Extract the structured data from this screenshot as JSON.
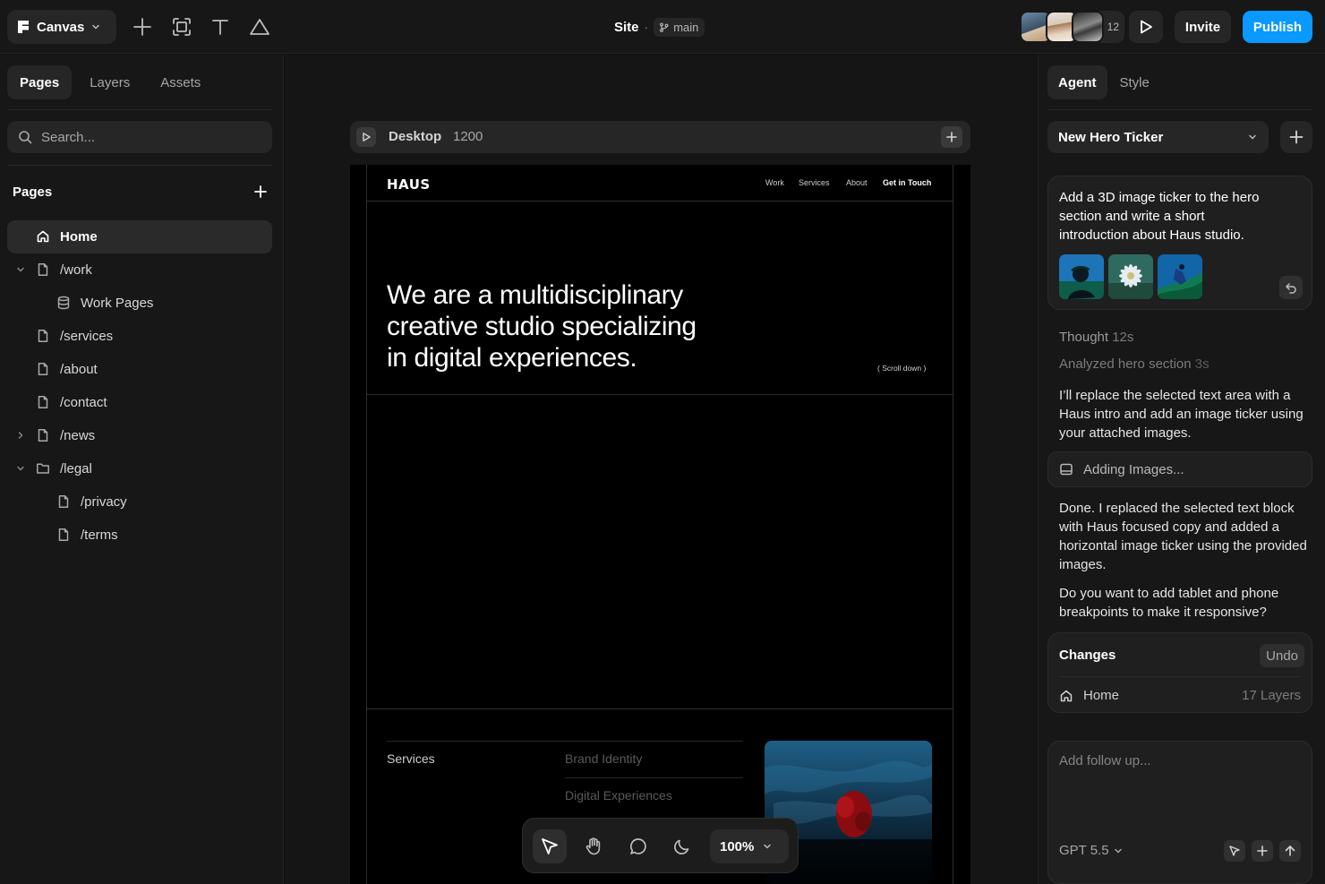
{
  "app": {
    "name": "Canvas",
    "site_name": "Site",
    "separator": "·",
    "branch": "main",
    "collaborator_count": "12",
    "invite_label": "Invite",
    "publish_label": "Publish",
    "colors": {
      "accent": "#0a99ff",
      "background": "#111111",
      "panel": "#171717",
      "surface": "#262626"
    }
  },
  "toolbar": {
    "tools": [
      "plus-icon",
      "frame-icon",
      "text-icon",
      "triangle-icon"
    ]
  },
  "left_panel": {
    "tabs": [
      {
        "label": "Pages",
        "active": true
      },
      {
        "label": "Layers",
        "active": false
      },
      {
        "label": "Assets",
        "active": false
      }
    ],
    "search_placeholder": "Search...",
    "pages_heading": "Pages",
    "pages": [
      {
        "label": "Home",
        "icon": "home-icon",
        "active": true
      },
      {
        "label": "/work",
        "icon": "file-icon",
        "expanded": true
      },
      {
        "label": "Work Pages",
        "icon": "database-icon"
      },
      {
        "label": "/services",
        "icon": "file-icon"
      },
      {
        "label": "/about",
        "icon": "file-icon"
      },
      {
        "label": "/contact",
        "icon": "file-icon"
      },
      {
        "label": "/news",
        "icon": "file-icon",
        "expanded": false
      },
      {
        "label": "/legal",
        "icon": "folder-icon",
        "expanded": true
      },
      {
        "label": "/privacy",
        "icon": "file-icon"
      },
      {
        "label": "/terms",
        "icon": "file-icon"
      }
    ]
  },
  "canvas": {
    "frame_label": "Desktop",
    "frame_width": "1200",
    "zoom": "100%",
    "site": {
      "logo": "HAUS",
      "nav": [
        "Work",
        "Services",
        "About"
      ],
      "nav_cta": "Get in Touch",
      "hero_lines": [
        "We are a multidisciplinary",
        "creative studio specializing",
        "in digital experiences."
      ],
      "scroll_hint": "( Scroll down )",
      "services_label": "Services",
      "services_items": [
        "Brand Identity",
        "Digital Experiences"
      ]
    }
  },
  "right_panel": {
    "tabs": [
      {
        "label": "Agent",
        "active": true
      },
      {
        "label": "Style",
        "active": false
      }
    ],
    "thread_title": "New Hero Ticker",
    "prompt": "Add a 3D image ticker to the hero section and write a short introduction about Haus studio.",
    "thought_label": "Thought",
    "thought_time": "12s",
    "analyzed_label": "Analyzed hero section",
    "analyzed_time": "3s",
    "message_1": "I’ll replace the selected text area with a Haus intro and add an image ticker using your attached images.",
    "status": "Adding Images...",
    "message_2": "Done. I replaced the selected text block with Haus focused copy and added a horizontal image ticker using the provided images.",
    "message_3": "Do you want to add tablet and phone breakpoints to make it responsive?",
    "changes": {
      "title": "Changes",
      "undo_label": "Undo",
      "page": "Home",
      "count": "17 Layers"
    },
    "followup_placeholder": "Add follow up...",
    "model": "GPT 5.5"
  }
}
